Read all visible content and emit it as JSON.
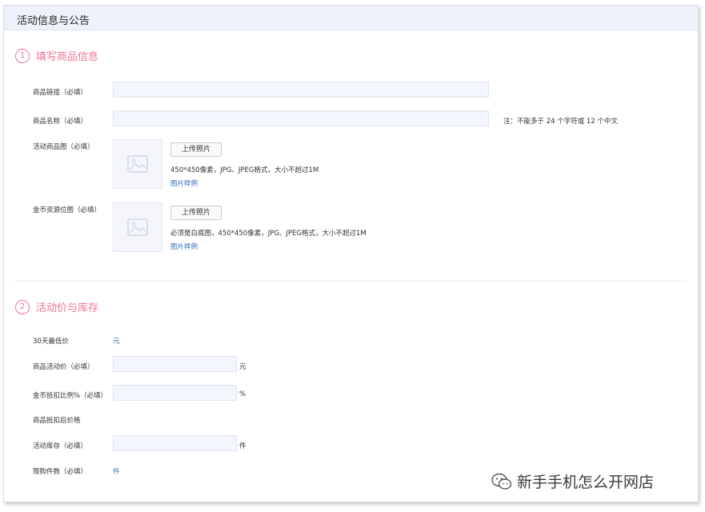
{
  "header": {
    "title": "活动信息与公告"
  },
  "section1": {
    "number": "1",
    "title": "填写商品信息",
    "fields": {
      "link_label": "商品链接（必填）",
      "name_label": "商品名称（必填）",
      "name_note": "注：不能多于 24 个字符或 12 个中文",
      "image_label": "活动商品图（必填）",
      "image_upload": "上传照片",
      "image_hint": "450*450像素，JPG、JPEG格式，大小不超过1M",
      "image_sample": "图片样例",
      "coin_label": "金币资源位图（必填）",
      "coin_upload": "上传照片",
      "coin_hint": "必须是白底图，450*450像素，JPG、JPEG格式，大小不超过1M",
      "coin_sample": "图片样例"
    }
  },
  "section2": {
    "number": "2",
    "title": "活动价与库存",
    "fields": {
      "lowest_label": "30天最低价",
      "lowest_unit": "元",
      "price_label": "商品活动价（必填）",
      "price_unit": "元",
      "ratio_label": "金币抵扣比例%（必填）",
      "ratio_unit": "%",
      "after_label": "商品抵扣后价格",
      "stock_label": "活动库存（必填）",
      "stock_unit": "件",
      "limit_label": "限购件数（必填）",
      "limit_unit": "件"
    }
  },
  "watermark": {
    "text": "新手手机怎么开网店"
  },
  "colors": {
    "accent": "#f0758f",
    "link": "#2f6fb8",
    "header_bg": "#eef3fb",
    "input_bg": "#f3f6fc"
  }
}
